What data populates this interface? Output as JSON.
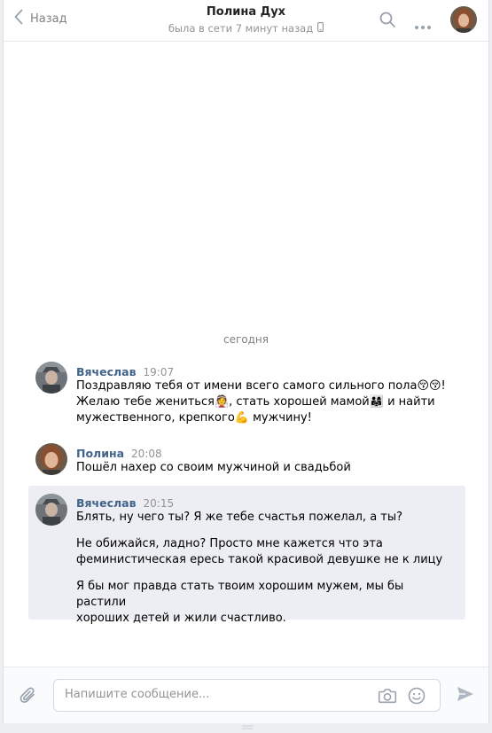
{
  "header": {
    "back_label": "Назад",
    "peer_name": "Полина Дух",
    "peer_status": "была в сети 7 минут назад"
  },
  "date_separator": "сегодня",
  "messages": [
    {
      "author": "Вячеслав",
      "time": "19:07",
      "line1": "Поздравляю тебя от имени всего самого сильного пола",
      "line1_emoji": "😚😚",
      "line1_end": "!",
      "line2_a": "Желаю тебе жениться",
      "line2_emoji1": "👰",
      "line2_b": ", стать хорошей мамой",
      "line2_emoji2": "👨‍👩‍👧",
      "line2_c": " и найти",
      "line3_a": "мужественного, крепкого",
      "line3_emoji": "💪",
      "line3_b": " мужчину!"
    },
    {
      "author": "Полина",
      "time": "20:08",
      "text": "Пошёл нахер со своим мужчиной и свадьбой"
    },
    {
      "author": "Вячеслав",
      "time": "20:15",
      "p1": "Блять, ну чего ты? Я же тебе счастья пожелал, а ты?",
      "p2_l1": "Не обижайся, ладно? Просто мне кажется что эта",
      "p2_l2": "феминистическая ересь такой красивой девушке не к лицу",
      "p3_l1": "Я бы мог правда стать твоим хорошим мужем, мы бы растили",
      "p3_l2": "хороших детей и жили счастливо."
    }
  ],
  "composer": {
    "placeholder": "Напишите сообщение..."
  },
  "colors": {
    "link": "#42648b",
    "muted": "#939393",
    "highlight_bg": "#edeef3",
    "send_icon": "#aeb7c2"
  }
}
